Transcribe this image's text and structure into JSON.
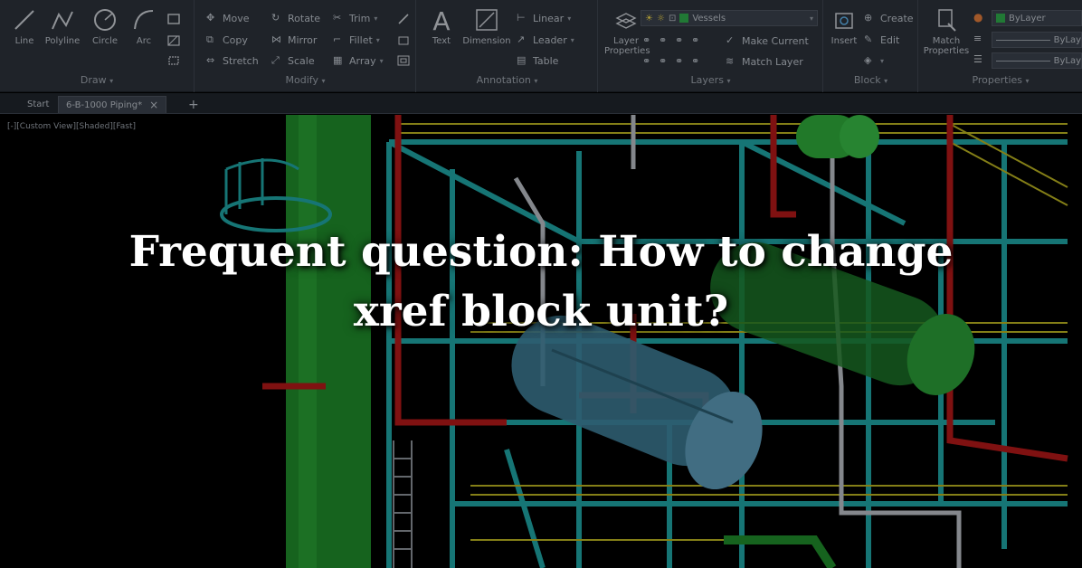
{
  "ribbon": {
    "panels": {
      "draw": "Draw",
      "modify": "Modify",
      "annotation": "Annotation",
      "layers": "Layers",
      "block": "Block",
      "properties": "Properties"
    },
    "draw_tools": {
      "line": "Line",
      "polyline": "Polyline",
      "circle": "Circle",
      "arc": "Arc"
    },
    "modify_tools": {
      "move": "Move",
      "rotate": "Rotate",
      "trim": "Trim",
      "copy": "Copy",
      "mirror": "Mirror",
      "fillet": "Fillet",
      "stretch": "Stretch",
      "scale": "Scale",
      "array": "Array"
    },
    "annotation_tools": {
      "text": "Text",
      "dimension": "Dimension",
      "linear": "Linear",
      "leader": "Leader",
      "table": "Table"
    },
    "layers_tools": {
      "layer_properties_1": "Layer",
      "layer_properties_2": "Properties",
      "layer_combo": "Vessels",
      "make_current": "Make Current",
      "match_layer": "Match Layer"
    },
    "block_tools": {
      "insert": "Insert",
      "create": "Create",
      "edit": "Edit"
    },
    "properties_tools": {
      "match_properties_1": "Match",
      "match_properties_2": "Properties",
      "color_combo": "ByLayer",
      "linetype_combo": "ByLay",
      "lineweight_combo": "ByLay"
    }
  },
  "tabs": {
    "start": "Start",
    "drawing": "6-B-1000 Piping*",
    "close": "×",
    "new": "+"
  },
  "viewport": {
    "label": "[-][Custom View][Shaded][Fast]"
  },
  "headline": {
    "line1": "Frequent question: How to change",
    "line2": "xref block unit?"
  },
  "colors": {
    "ribbon_bg": "#2b313a",
    "steel": "#1fa3a3",
    "pipe_green": "#1f8a2a",
    "pipe_red": "#b01818",
    "rail_yellow": "#b8b020",
    "vessel_blue": "#3f7f9a"
  }
}
